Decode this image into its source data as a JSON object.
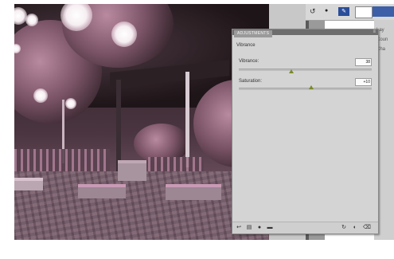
{
  "adjustments_panel": {
    "tab_label": "ADJUSTMENTS",
    "subtitle": "Vibrance",
    "vibrance": {
      "label": "Vibrance:",
      "value": "38"
    },
    "saturation": {
      "label": "Saturation:",
      "value": "+10"
    }
  },
  "layers_panel": {
    "items": [
      "Lay",
      "Coun",
      "Cha"
    ]
  },
  "colors": {
    "thumb": "#7a8a2a",
    "panel_bg": "#d4d4d4"
  },
  "icons": [
    "return-icon",
    "layers-icon",
    "eye-icon",
    "mask-icon",
    "reset-icon",
    "visibility-icon",
    "delete-icon"
  ]
}
